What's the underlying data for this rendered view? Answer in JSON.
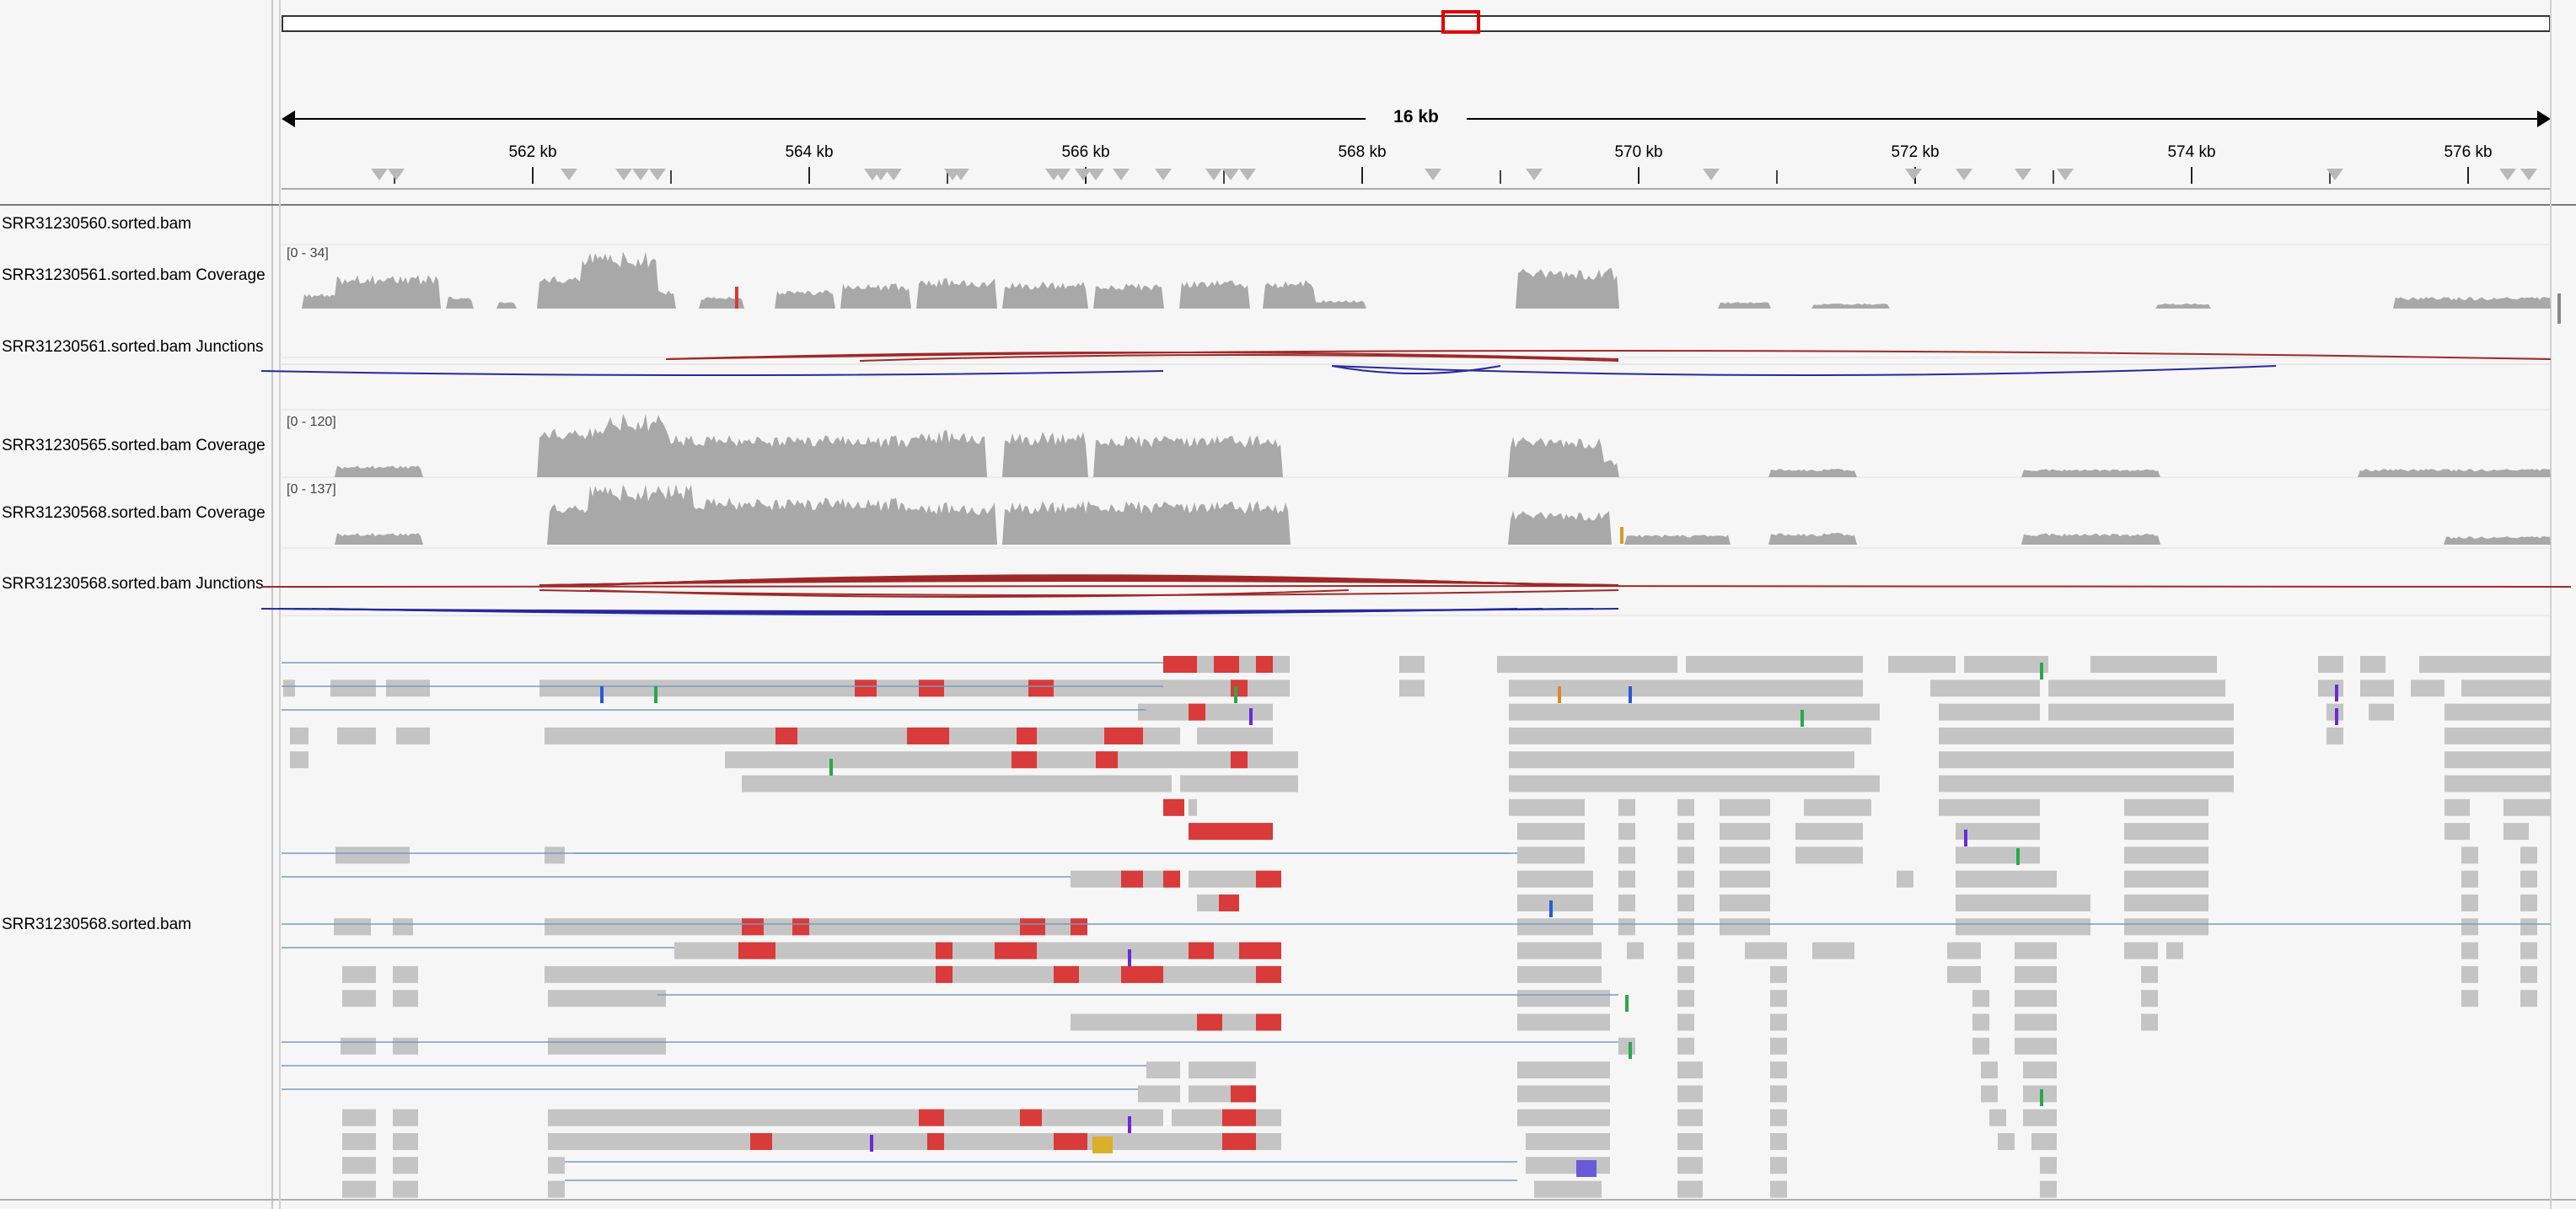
{
  "ruler": {
    "span_label": "16 kb",
    "ticks": [
      "562 kb",
      "564 kb",
      "566 kb",
      "568 kb",
      "570 kb",
      "572 kb",
      "574 kb",
      "576 kb"
    ]
  },
  "tracks": [
    {
      "name": "SRR31230560.sorted.bam"
    },
    {
      "name": "SRR31230561.sorted.bam Coverage",
      "scale": "[0 - 34]"
    },
    {
      "name": "SRR31230561.sorted.bam Junctions"
    },
    {
      "name": "SRR31230565.sorted.bam Coverage",
      "scale": "[0 - 120]"
    },
    {
      "name": "SRR31230568.sorted.bam Coverage",
      "scale": "[0 - 137]"
    },
    {
      "name": "SRR31230568.sorted.bam Junctions"
    },
    {
      "name": "SRR31230568.sorted.bam"
    }
  ],
  "colors": {
    "coverage": "#a8a8a8",
    "read": "#c4c4c4",
    "mismatch_read": "#d93a3a",
    "junction_forward": "#a02828",
    "junction_reverse": "#2828a0",
    "region_box": "#e00000"
  }
}
